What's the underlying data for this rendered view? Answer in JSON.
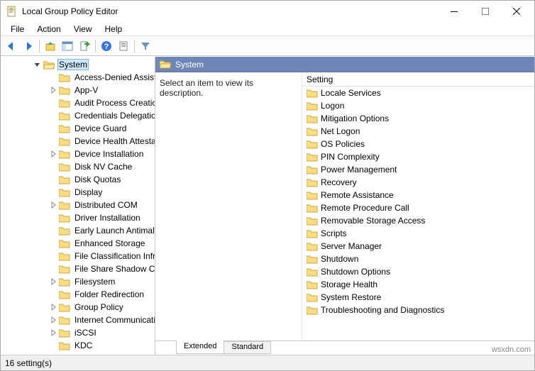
{
  "window": {
    "title": "Local Group Policy Editor"
  },
  "menu": {
    "file": "File",
    "action": "Action",
    "view": "View",
    "help": "Help"
  },
  "right": {
    "title": "System",
    "description": "Select an item to view its description.",
    "column_header": "Setting"
  },
  "tree": {
    "root": "System",
    "items": [
      {
        "label": "Access-Denied Assistance",
        "exp": false
      },
      {
        "label": "App-V",
        "exp": true
      },
      {
        "label": "Audit Process Creation",
        "exp": false
      },
      {
        "label": "Credentials Delegation",
        "exp": false
      },
      {
        "label": "Device Guard",
        "exp": false
      },
      {
        "label": "Device Health Attestation",
        "exp": false
      },
      {
        "label": "Device Installation",
        "exp": true
      },
      {
        "label": "Disk NV Cache",
        "exp": false
      },
      {
        "label": "Disk Quotas",
        "exp": false
      },
      {
        "label": "Display",
        "exp": false
      },
      {
        "label": "Distributed COM",
        "exp": true
      },
      {
        "label": "Driver Installation",
        "exp": false
      },
      {
        "label": "Early Launch Antimalware",
        "exp": false
      },
      {
        "label": "Enhanced Storage",
        "exp": false
      },
      {
        "label": "File Classification Infrastructure",
        "exp": false
      },
      {
        "label": "File Share Shadow Copy",
        "exp": false
      },
      {
        "label": "Filesystem",
        "exp": true
      },
      {
        "label": "Folder Redirection",
        "exp": false
      },
      {
        "label": "Group Policy",
        "exp": true
      },
      {
        "label": "Internet Communication",
        "exp": true
      },
      {
        "label": "iSCSI",
        "exp": true
      },
      {
        "label": "KDC",
        "exp": false
      }
    ]
  },
  "list": {
    "items": [
      "Locale Services",
      "Logon",
      "Mitigation Options",
      "Net Logon",
      "OS Policies",
      "PIN Complexity",
      "Power Management",
      "Recovery",
      "Remote Assistance",
      "Remote Procedure Call",
      "Removable Storage Access",
      "Scripts",
      "Server Manager",
      "Shutdown",
      "Shutdown Options",
      "Storage Health",
      "System Restore",
      "Troubleshooting and Diagnostics"
    ]
  },
  "tabs": {
    "extended": "Extended",
    "standard": "Standard"
  },
  "status": "16 setting(s)",
  "watermark": "wsxdn.com"
}
